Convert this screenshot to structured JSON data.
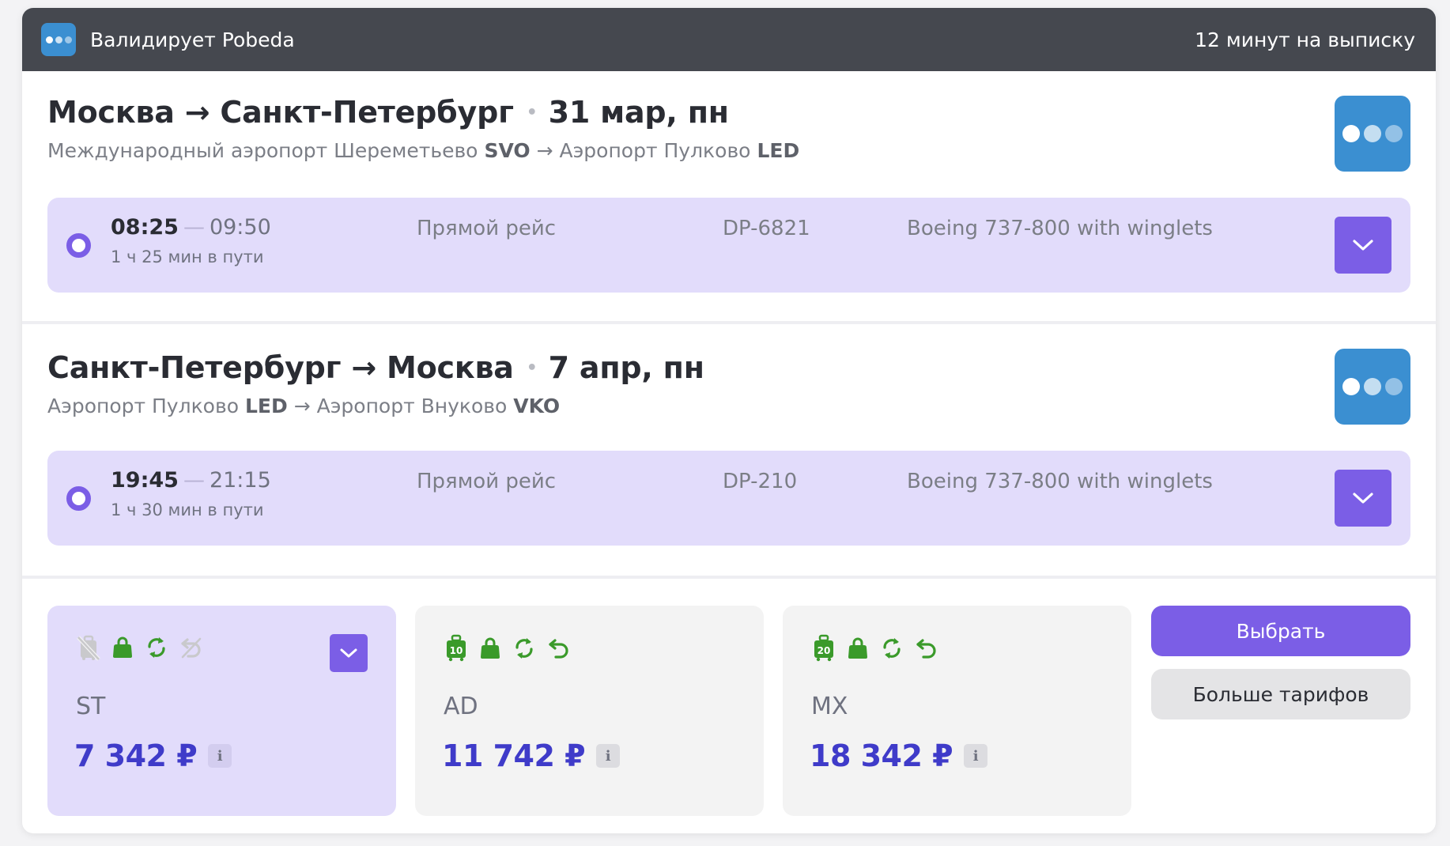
{
  "header": {
    "title": "Валидирует Pobeda",
    "timer": "12 минут на выписку"
  },
  "colors": {
    "accent": "#7b5ee6",
    "airline_logo": "#3b8fd1",
    "price": "#3f3bc9",
    "icon_available": "#3a9a2a",
    "icon_unavailable": "#c9c9cc"
  },
  "segments": [
    {
      "route": "Москва → Санкт-Петербург",
      "date": "31 мар, пн",
      "from_airport": "Международный аэропорт Шереметьево",
      "from_code": "SVO",
      "to_airport": "Аэропорт Пулково",
      "to_code": "LED",
      "arrow": "→",
      "flight": {
        "departure": "08:25",
        "dash": "—",
        "arrival": "09:50",
        "duration": "1 ч 25 мин в пути",
        "type": "Прямой рейс",
        "number": "DP-6821",
        "aircraft": "Boeing 737-800 with winglets"
      }
    },
    {
      "route": "Санкт-Петербург → Москва",
      "date": "7 апр, пн",
      "from_airport": "Аэропорт Пулково",
      "from_code": "LED",
      "to_airport": "Аэропорт Внуково",
      "to_code": "VKO",
      "arrow": "→",
      "flight": {
        "departure": "19:45",
        "dash": "—",
        "arrival": "21:15",
        "duration": "1 ч 30 мин в пути",
        "type": "Прямой рейс",
        "number": "DP-210",
        "aircraft": "Boeing 737-800 with winglets"
      }
    }
  ],
  "tariffs": [
    {
      "name": "ST",
      "price": "7 342 ₽",
      "info": "i",
      "selected": true,
      "icons": [
        "no-checked-baggage-icon",
        "hand-luggage-icon",
        "exchange-icon",
        "no-refund-icon"
      ]
    },
    {
      "name": "AD",
      "price": "11 742 ₽",
      "info": "i",
      "selected": false,
      "baggage_kg": "10",
      "icons": [
        "checked-baggage-10kg-icon",
        "hand-luggage-icon",
        "exchange-icon",
        "refund-icon"
      ]
    },
    {
      "name": "MX",
      "price": "18 342 ₽",
      "info": "i",
      "selected": false,
      "baggage_kg": "20",
      "icons": [
        "checked-baggage-20kg-icon",
        "hand-luggage-icon",
        "exchange-icon",
        "refund-icon"
      ]
    }
  ],
  "actions": {
    "choose": "Выбрать",
    "more": "Больше тарифов"
  }
}
